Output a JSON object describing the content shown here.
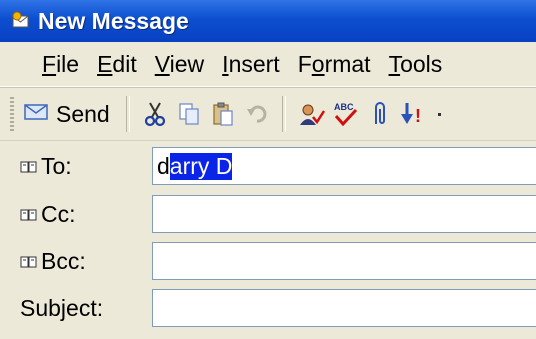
{
  "window": {
    "title": "New Message"
  },
  "menu": [
    {
      "mnemonic": "F",
      "rest": "ile"
    },
    {
      "mnemonic": "E",
      "rest": "dit"
    },
    {
      "mnemonic": "V",
      "rest": "iew"
    },
    {
      "mnemonic": "I",
      "rest": "nsert"
    },
    {
      "pre": "F",
      "mnemonic": "o",
      "rest": "rmat"
    },
    {
      "mnemonic": "T",
      "rest": "ools"
    }
  ],
  "toolbar": {
    "send_label": "Send",
    "icons": [
      "send-icon",
      "cut-icon",
      "copy-icon",
      "paste-icon",
      "undo-icon",
      "check-names-icon",
      "spelling-icon",
      "attach-icon",
      "priority-icon",
      "dropdown-arrow-icon"
    ]
  },
  "headers": {
    "to_label": "To:",
    "to_value_plain": "d",
    "to_value_selected": "arry D",
    "cc_label": "Cc:",
    "cc_value": "",
    "bcc_label": "Bcc:",
    "bcc_value": "",
    "subject_label": "Subject:",
    "subject_value": ""
  }
}
